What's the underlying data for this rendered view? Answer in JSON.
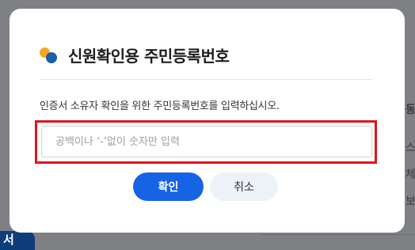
{
  "dialog": {
    "title": "신원확인용 주민등록번호",
    "description": "인증서 소유자 확인을 위한 주민등록번호를 입력하십시오.",
    "input": {
      "value": "",
      "placeholder": "공백이나 ‘-’없이 숫자만 입력"
    },
    "confirm_label": "확인",
    "cancel_label": "취소"
  },
  "background": {
    "button_label": "서",
    "right_fragments": [
      "동",
      "스",
      "체",
      "보"
    ]
  },
  "colors": {
    "accent": "#1763e6",
    "highlight_border": "#e0141c",
    "logo_orange": "#f5a623",
    "logo_blue": "#1a5fa8"
  },
  "icons": {
    "logo": "brand-dots-icon"
  }
}
